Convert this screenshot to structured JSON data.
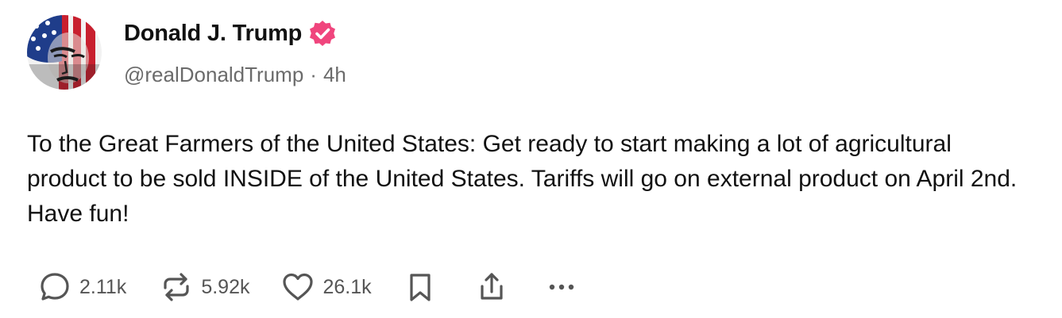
{
  "post": {
    "author": {
      "display_name": "Donald J. Trump",
      "handle": "@realDonaldTrump",
      "separator": "·",
      "time_ago": "4h",
      "verified_color": "#f0457d"
    },
    "text": "To the Great Farmers of the United States: Get ready to start making a lot of agricultural product to be sold INSIDE of the United States. Tariffs will go on external product on April 2nd. Have fun!",
    "actions": {
      "replies": "2.11k",
      "reposts": "5.92k",
      "likes": "26.1k"
    },
    "icons": {
      "reply": "reply-bubble-icon",
      "repost": "repost-arrows-icon",
      "like": "heart-icon",
      "bookmark": "bookmark-icon",
      "share": "share-icon",
      "more": "more-dots-icon"
    }
  }
}
